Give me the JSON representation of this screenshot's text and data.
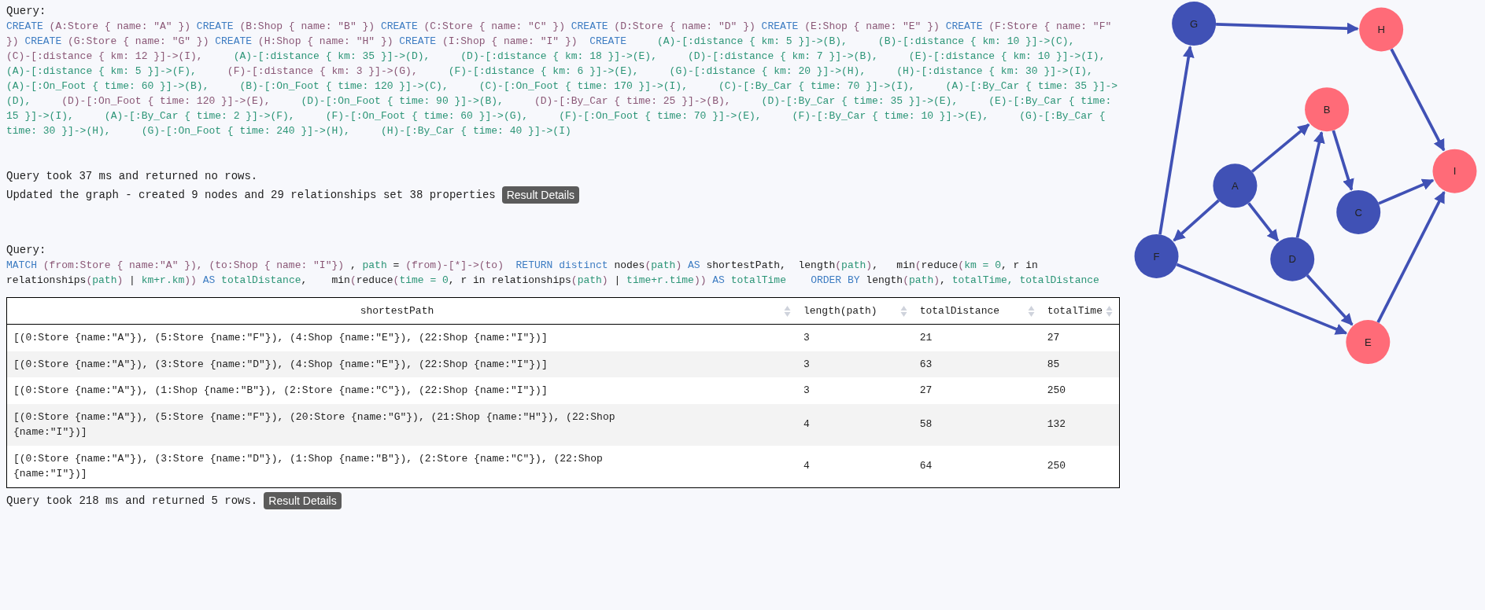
{
  "blocks": [
    {
      "kind": "create",
      "query_label": "Query:",
      "query": [
        {
          "kind": "keyword",
          "text": "CREATE "
        },
        {
          "kind": "node",
          "text": "(A:Store { name: \"A\" }) "
        },
        {
          "kind": "keyword",
          "text": "CREATE "
        },
        {
          "kind": "node",
          "text": "(B:Shop { name: \"B\" }) "
        },
        {
          "kind": "keyword",
          "text": "CREATE "
        },
        {
          "kind": "node",
          "text": "(C:Store { name: \"C\" }) "
        },
        {
          "kind": "keyword",
          "text": "CREATE "
        },
        {
          "kind": "node",
          "text": "(D:Store { name: \"D\" }) "
        },
        {
          "kind": "keyword",
          "text": "CREATE "
        },
        {
          "kind": "node",
          "text": "(E:Shop { name: \"E\" }) "
        },
        {
          "kind": "keyword",
          "text": "CREATE "
        },
        {
          "kind": "node",
          "text": "(F:Store { name: \"F\" }) "
        },
        {
          "kind": "keyword",
          "text": "CREATE "
        },
        {
          "kind": "node",
          "text": "(G:Store { name: \"G\" }) "
        },
        {
          "kind": "keyword",
          "text": "CREATE "
        },
        {
          "kind": "node",
          "text": "(H:Shop { name: \"H\" }) "
        },
        {
          "kind": "keyword",
          "text": "CREATE "
        },
        {
          "kind": "node",
          "text": "(I:Shop { name: \"I\" })  "
        },
        {
          "kind": "keyword",
          "text": "CREATE     "
        },
        {
          "kind": "rel",
          "text": "(A)-[:distance { km: 5 }]->(B),     "
        },
        {
          "kind": "rel",
          "text": "(B)-[:distance { km: 10 }]->(C),     "
        },
        {
          "kind": "node",
          "text": "(C)-[:distance { km: 12 }]->(I),     "
        },
        {
          "kind": "rel",
          "text": "(A)-[:distance { km: 35 }]->(D),     "
        },
        {
          "kind": "rel",
          "text": "(D)-[:distance { km: 18 }]->(E),     "
        },
        {
          "kind": "rel",
          "text": "(D)-[:distance { km: 7 }]->(B),     "
        },
        {
          "kind": "rel",
          "text": "(E)-[:distance { km: 10 }]->(I),     "
        },
        {
          "kind": "rel",
          "text": "(A)-[:distance { km: 5 }]->(F),     "
        },
        {
          "kind": "node",
          "text": "(F)-[:distance { km: 3 }]->(G),     "
        },
        {
          "kind": "rel",
          "text": "(F)-[:distance { km: 6 }]->(E),     "
        },
        {
          "kind": "rel",
          "text": "(G)-[:distance { km: 20 }]->(H),     "
        },
        {
          "kind": "rel",
          "text": "(H)-[:distance { km: 30 }]->(I),     "
        },
        {
          "kind": "rel",
          "text": "(A)-[:On_Foot { time: 60 }]->(B),     "
        },
        {
          "kind": "rel",
          "text": "(B)-[:On_Foot { time: 120 }]->(C),     "
        },
        {
          "kind": "rel",
          "text": "(C)-[:On_Foot { time: 170 }]->(I),     "
        },
        {
          "kind": "rel",
          "text": "(C)-[:By_Car { time: 70 }]->(I),     "
        },
        {
          "kind": "rel",
          "text": "(A)-[:By_Car { time: 35 }]->(D),     "
        },
        {
          "kind": "node",
          "text": "(D)-[:On_Foot { time: 120 }]->(E),     "
        },
        {
          "kind": "rel",
          "text": "(D)-[:On_Foot { time: 90 }]->(B),     "
        },
        {
          "kind": "node",
          "text": "(D)-[:By_Car { time: 25 }]->(B),     "
        },
        {
          "kind": "rel",
          "text": "(D)-[:By_Car { time: 35 }]->(E),     "
        },
        {
          "kind": "rel",
          "text": "(E)-[:By_Car { time: 15 }]->(I),     "
        },
        {
          "kind": "rel",
          "text": "(A)-[:By_Car { time: 2 }]->(F),     "
        },
        {
          "kind": "rel",
          "text": "(F)-[:On_Foot { time: 60 }]->(G),     "
        },
        {
          "kind": "rel",
          "text": "(F)-[:On_Foot { time: 70 }]->(E),     "
        },
        {
          "kind": "rel",
          "text": "(F)-[:By_Car { time: 10 }]->(E),     "
        },
        {
          "kind": "rel",
          "text": "(G)-[:By_Car { time: 30 }]->(H),     "
        },
        {
          "kind": "rel",
          "text": "(G)-[:On_Foot { time: 240 }]->(H),     "
        },
        {
          "kind": "rel",
          "text": "(H)-[:By_Car { time: 40 }]->(I)"
        }
      ],
      "messages": [
        "Query took 37 ms and returned no rows.",
        "Updated the graph - created 9 nodes and 29 relationships set 38 properties"
      ],
      "button": "Result Details"
    },
    {
      "kind": "match",
      "query_label": "Query:",
      "query": [
        {
          "kind": "keyword",
          "text": "MATCH "
        },
        {
          "kind": "node",
          "text": "(from:Store { name:\"A\" }), (to:Shop { name: \"I\"}) "
        },
        {
          "kind": "plain",
          "text": ", "
        },
        {
          "kind": "rel",
          "text": "path"
        },
        {
          "kind": "plain",
          "text": " = "
        },
        {
          "kind": "node",
          "text": "(from)-[*]->(to)  "
        },
        {
          "kind": "keyword",
          "text": "RETURN distinct "
        },
        {
          "kind": "plain",
          "text": "nodes"
        },
        {
          "kind": "node",
          "text": "("
        },
        {
          "kind": "rel",
          "text": "path"
        },
        {
          "kind": "node",
          "text": ") "
        },
        {
          "kind": "keyword",
          "text": "AS "
        },
        {
          "kind": "plain",
          "text": "shortestPath,  length"
        },
        {
          "kind": "node",
          "text": "("
        },
        {
          "kind": "rel",
          "text": "path"
        },
        {
          "kind": "node",
          "text": ")"
        },
        {
          "kind": "plain",
          "text": ",   min"
        },
        {
          "kind": "node",
          "text": "("
        },
        {
          "kind": "plain",
          "text": "reduce"
        },
        {
          "kind": "node",
          "text": "("
        },
        {
          "kind": "rel",
          "text": "km = 0"
        },
        {
          "kind": "plain",
          "text": ", r in relationships"
        },
        {
          "kind": "node",
          "text": "("
        },
        {
          "kind": "rel",
          "text": "path"
        },
        {
          "kind": "node",
          "text": ") "
        },
        {
          "kind": "plain",
          "text": "| "
        },
        {
          "kind": "rel",
          "text": "km+r.km"
        },
        {
          "kind": "node",
          "text": ")) "
        },
        {
          "kind": "keyword",
          "text": "AS "
        },
        {
          "kind": "rel",
          "text": "totalDistance"
        },
        {
          "kind": "plain",
          "text": ",    min"
        },
        {
          "kind": "node",
          "text": "("
        },
        {
          "kind": "plain",
          "text": "reduce"
        },
        {
          "kind": "node",
          "text": "("
        },
        {
          "kind": "rel",
          "text": "time = 0"
        },
        {
          "kind": "plain",
          "text": ", r in relationships"
        },
        {
          "kind": "node",
          "text": "("
        },
        {
          "kind": "rel",
          "text": "path"
        },
        {
          "kind": "node",
          "text": ") "
        },
        {
          "kind": "plain",
          "text": "| "
        },
        {
          "kind": "rel",
          "text": "time+r.time"
        },
        {
          "kind": "node",
          "text": ")) "
        },
        {
          "kind": "keyword",
          "text": "AS "
        },
        {
          "kind": "rel",
          "text": "totalTime    "
        },
        {
          "kind": "keyword",
          "text": "ORDER BY "
        },
        {
          "kind": "plain",
          "text": "length"
        },
        {
          "kind": "node",
          "text": "("
        },
        {
          "kind": "rel",
          "text": "path"
        },
        {
          "kind": "node",
          "text": ")"
        },
        {
          "kind": "plain",
          "text": ", "
        },
        {
          "kind": "rel",
          "text": "totalTime, totalDistance"
        }
      ],
      "table": {
        "columns": [
          "shortestPath",
          "length(path)",
          "totalDistance",
          "totalTime"
        ],
        "rows": [
          [
            "[(0:Store {name:\"A\"}), (5:Store {name:\"F\"}), (4:Shop {name:\"E\"}), (22:Shop {name:\"I\"})]",
            "3",
            "21",
            "27"
          ],
          [
            "[(0:Store {name:\"A\"}), (3:Store {name:\"D\"}), (4:Shop {name:\"E\"}), (22:Shop {name:\"I\"})]",
            "3",
            "63",
            "85"
          ],
          [
            "[(0:Store {name:\"A\"}), (1:Shop {name:\"B\"}), (2:Store {name:\"C\"}), (22:Shop {name:\"I\"})]",
            "3",
            "27",
            "250"
          ],
          [
            "[(0:Store {name:\"A\"}), (5:Store {name:\"F\"}), (20:Store {name:\"G\"}), (21:Shop {name:\"H\"}), (22:Shop {name:\"I\"})]",
            "4",
            "58",
            "132"
          ],
          [
            "[(0:Store {name:\"A\"}), (3:Store {name:\"D\"}), (1:Shop {name:\"B\"}), (2:Store {name:\"C\"}), (22:Shop {name:\"I\"})]",
            "4",
            "64",
            "250"
          ]
        ]
      },
      "messages": [
        "Query took 218 ms and returned 5 rows."
      ],
      "button": "Result Details"
    }
  ],
  "graph": {
    "nodes": [
      {
        "label": "G",
        "color": "#4051b5"
      },
      {
        "label": "H",
        "color": "#ff6b78"
      },
      {
        "label": "B",
        "color": "#ff6b78"
      },
      {
        "label": "I",
        "color": "#ff6b78"
      },
      {
        "label": "A",
        "color": "#4051b5"
      },
      {
        "label": "C",
        "color": "#4051b5"
      },
      {
        "label": "F",
        "color": "#4051b5"
      },
      {
        "label": "D",
        "color": "#4051b5"
      },
      {
        "label": "E",
        "color": "#ff6b78"
      }
    ]
  }
}
